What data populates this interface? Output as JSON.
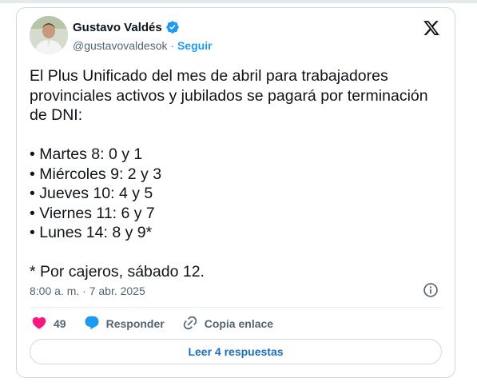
{
  "tweet": {
    "author_name": "Gustavo Valdés",
    "author_handle": "@gustavovaldesok",
    "separator": " · ",
    "follow_label": "Seguir",
    "lines": [
      "El Plus Unificado del mes de abril para trabajadores provinciales activos y jubilados se pagará por terminación de DNI:",
      "",
      "• Martes 8: 0 y 1",
      "• Miércoles 9: 2 y 3",
      "• Jueves 10: 4 y 5",
      "• Viernes 11: 6 y 7",
      "• Lunes 14: 8 y 9*",
      "",
      "* Por cajeros, sábado 12."
    ],
    "timestamp": "8:00 a. m. · 7 abr. 2025",
    "likes_count": "49",
    "reply_label": "Responder",
    "copy_link_label": "Copia enlace",
    "read_replies_label": "Leer 4 respuestas"
  },
  "icons": {
    "verified": "verified-badge-icon",
    "platform": "x-logo-icon",
    "info": "info-icon",
    "like": "heart-icon",
    "reply": "speech-bubble-icon",
    "link": "link-icon"
  },
  "colors": {
    "accent": "#1d9bf0",
    "like": "#f91880",
    "muted_text": "#536471",
    "text": "#0f1419",
    "border": "#cfd9de"
  }
}
